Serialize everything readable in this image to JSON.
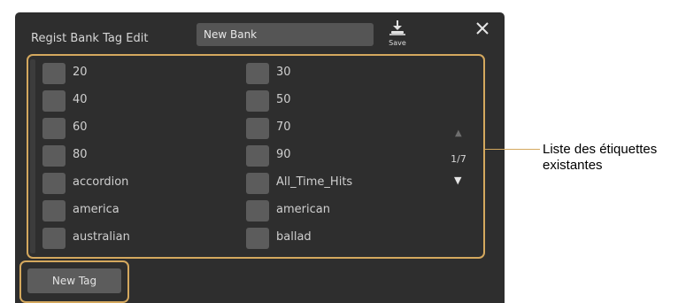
{
  "window": {
    "title": "Regist Bank Tag Edit",
    "bank_name": "New Bank",
    "save_label": "Save",
    "save_icon": "save-icon",
    "close_icon": "close-icon"
  },
  "tags": {
    "left": [
      "20",
      "40",
      "60",
      "80",
      "accordion",
      "america",
      "australian"
    ],
    "right": [
      "30",
      "50",
      "70",
      "90",
      "All_Time_Hits",
      "american",
      "ballad"
    ]
  },
  "pagination": {
    "page": "1/7",
    "up_icon": "up-arrow-icon",
    "down_icon": "down-arrow-icon"
  },
  "new_tag_label": "New Tag",
  "callout": {
    "line1": "Liste des étiquettes",
    "line2": "existantes"
  },
  "colors": {
    "panel": "#2e2e2e",
    "highlight": "#d4a85e",
    "checkbox": "#5c5c5c"
  }
}
